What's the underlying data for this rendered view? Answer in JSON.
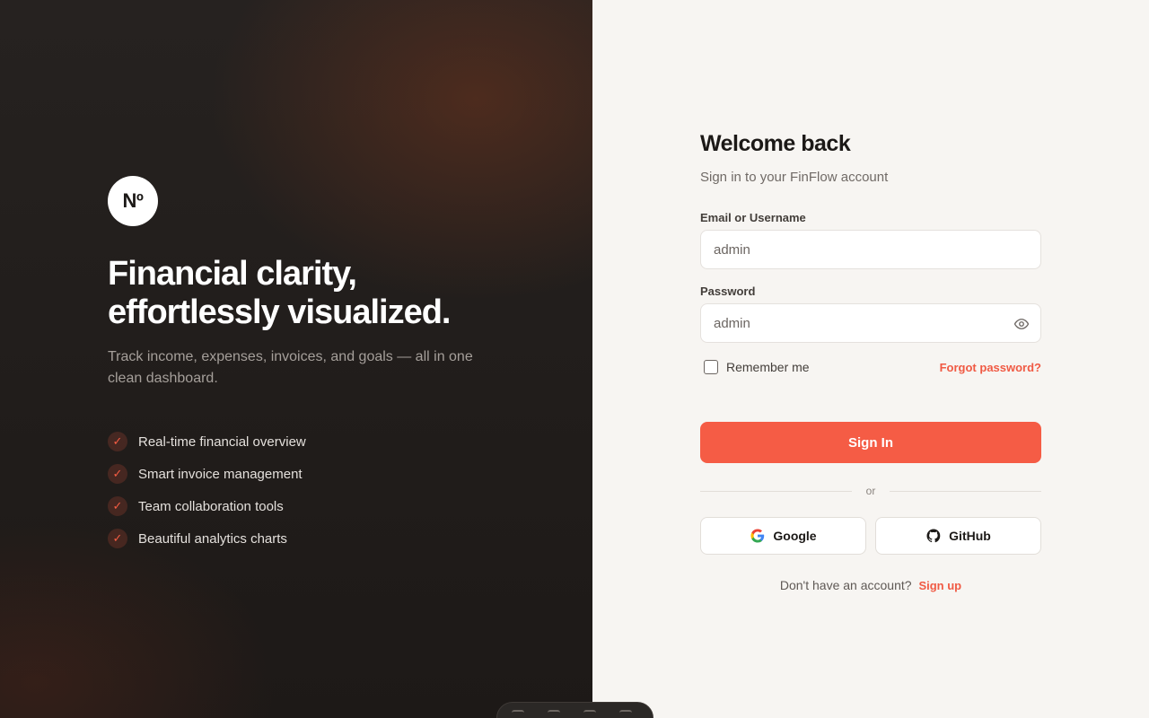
{
  "brand": {
    "logo_text": "Nº",
    "headline_line1": "Financial clarity,",
    "headline_line2": "effortlessly visualized.",
    "tagline": "Track income, expenses, invoices, and goals — all in one clean dashboard.",
    "check_glyph": "✓",
    "features": [
      {
        "label": "Real-time financial overview"
      },
      {
        "label": "Smart invoice management"
      },
      {
        "label": "Team collaboration tools"
      },
      {
        "label": "Beautiful analytics charts"
      }
    ]
  },
  "login": {
    "title": "Welcome back",
    "subtitle": "Sign in to your FinFlow account",
    "email_label": "Email or Username",
    "email_value": "admin",
    "password_label": "Password",
    "password_value": "admin",
    "remember_label": "Remember me",
    "remember_checked": false,
    "forgot_label": "Forgot password?",
    "signin_label": "Sign In",
    "divider_label": "or",
    "google_label": "Google",
    "github_label": "GitHub",
    "no_account_text": "Don't have an account?",
    "signup_label": "Sign up"
  },
  "colors": {
    "accent": "#f55c45",
    "left_panel_bg": "#211d1b",
    "right_panel_bg": "#f7f5f2"
  },
  "icons": [
    "check-icon",
    "eye-icon",
    "google-icon",
    "github-icon"
  ]
}
